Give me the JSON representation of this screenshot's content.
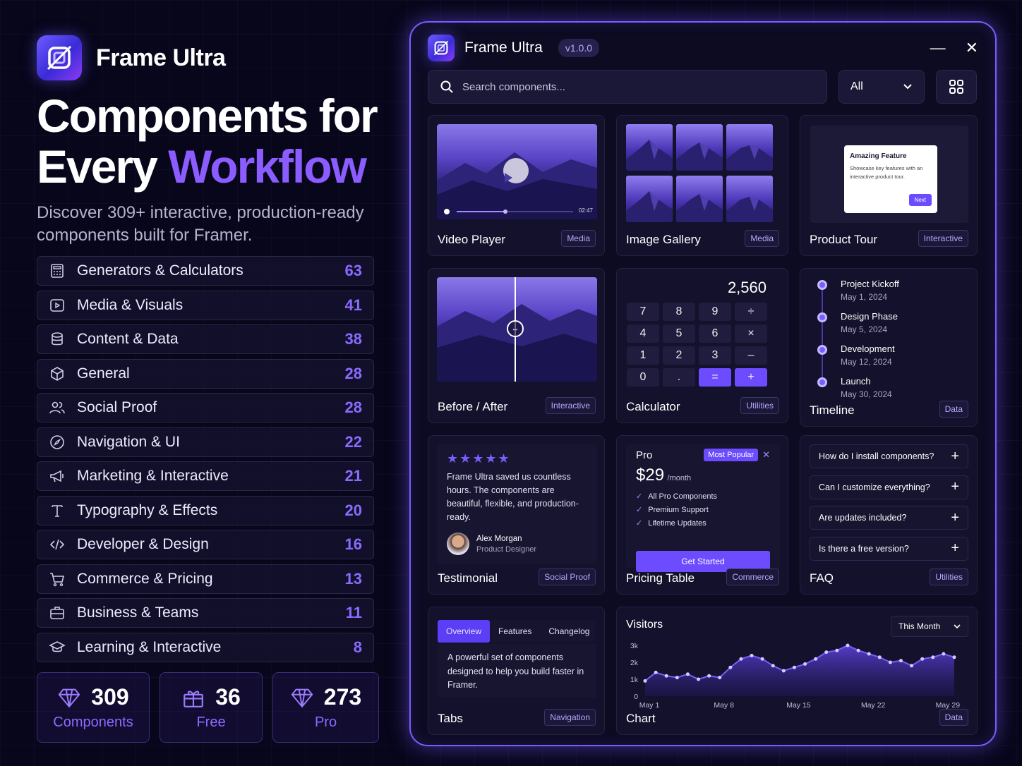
{
  "brand": {
    "name": "Frame Ultra"
  },
  "hero": {
    "line1": "Components for",
    "line2_plain": "Every",
    "line2_accent": "Workflow"
  },
  "subtitle": {
    "line1": "Discover 309+ interactive, production-ready",
    "line2": "components built for Framer."
  },
  "categories": [
    {
      "label": "Generators & Calculators",
      "count": "63",
      "icon": "calculator-icon"
    },
    {
      "label": "Media & Visuals",
      "count": "41",
      "icon": "play-icon"
    },
    {
      "label": "Content & Data",
      "count": "38",
      "icon": "database-icon"
    },
    {
      "label": "General",
      "count": "28",
      "icon": "box-icon"
    },
    {
      "label": "Social Proof",
      "count": "28",
      "icon": "users-icon"
    },
    {
      "label": "Navigation & UI",
      "count": "22",
      "icon": "compass-icon"
    },
    {
      "label": "Marketing & Interactive",
      "count": "21",
      "icon": "megaphone-icon"
    },
    {
      "label": "Typography & Effects",
      "count": "20",
      "icon": "type-icon"
    },
    {
      "label": "Developer & Design",
      "count": "16",
      "icon": "code-icon"
    },
    {
      "label": "Commerce & Pricing",
      "count": "13",
      "icon": "cart-icon"
    },
    {
      "label": "Business & Teams",
      "count": "11",
      "icon": "briefcase-icon"
    },
    {
      "label": "Learning & Interactive",
      "count": "8",
      "icon": "graduation-icon"
    }
  ],
  "stats": [
    {
      "num": "309",
      "label": "Components",
      "icon": "diamond-icon"
    },
    {
      "num": "36",
      "label": "Free",
      "icon": "gift-icon"
    },
    {
      "num": "273",
      "label": "Pro",
      "icon": "diamond-icon"
    }
  ],
  "window": {
    "title": "Frame Ultra",
    "version": "v1.0.0",
    "search_placeholder": "Search components...",
    "filter": "All"
  },
  "cards": {
    "video": {
      "name": "Video Player",
      "tag": "Media",
      "time": "02:47"
    },
    "gallery": {
      "name": "Image Gallery",
      "tag": "Media"
    },
    "tour": {
      "name": "Product Tour",
      "tag": "Interactive",
      "pop_title": "Amazing Feature",
      "pop_text": "Showcase key features with an interactive product tour.",
      "pop_btn": "Next"
    },
    "before": {
      "name": "Before / After",
      "tag": "Interactive"
    },
    "calc": {
      "name": "Calculator",
      "tag": "Utilities",
      "display": "2,560",
      "keys": [
        "7",
        "8",
        "9",
        "÷",
        "4",
        "5",
        "6",
        "×",
        "1",
        "2",
        "3",
        "–",
        "0",
        ".",
        "=",
        "+"
      ]
    },
    "timeline": {
      "name": "Timeline",
      "tag": "Data",
      "items": [
        {
          "title": "Project Kickoff",
          "date": "May 1, 2024"
        },
        {
          "title": "Design Phase",
          "date": "May 5, 2024"
        },
        {
          "title": "Development",
          "date": "May 12, 2024"
        },
        {
          "title": "Launch",
          "date": "May 30, 2024"
        }
      ]
    },
    "testimonial": {
      "name": "Testimonial",
      "tag": "Social Proof",
      "stars": "★★★★★",
      "quote": "Frame Ultra saved us countless hours. The components are beautiful, flexible, and production-ready.",
      "author": "Alex Morgan",
      "role": "Product Designer"
    },
    "pricing": {
      "name": "Pricing Table",
      "tag": "Commerce",
      "plan": "Pro",
      "badge": "Most Popular",
      "price": "$29",
      "period": "/month",
      "features": [
        "All Pro Components",
        "Premium Support",
        "Lifetime Updates"
      ],
      "cta": "Get Started"
    },
    "faq": {
      "name": "FAQ",
      "tag": "Utilities",
      "items": [
        "How do I install components?",
        "Can I customize everything?",
        "Are updates included?",
        "Is there a free version?"
      ]
    },
    "tabs": {
      "name": "Tabs",
      "tag": "Navigation",
      "tabs": [
        "Overview",
        "Features",
        "Changelog"
      ],
      "content": "A powerful set of components designed to help you build faster in Framer."
    },
    "chart": {
      "name": "Chart",
      "tag": "Data",
      "title": "Visitors",
      "range": "This Month"
    }
  },
  "chart_data": {
    "type": "area",
    "title": "Visitors",
    "x": [
      "May 1",
      "May 2",
      "May 3",
      "May 4",
      "May 5",
      "May 6",
      "May 7",
      "May 8",
      "May 9",
      "May 10",
      "May 11",
      "May 12",
      "May 13",
      "May 14",
      "May 15",
      "May 16",
      "May 17",
      "May 18",
      "May 19",
      "May 20",
      "May 21",
      "May 22",
      "May 23",
      "May 24",
      "May 25",
      "May 26",
      "May 27",
      "May 28",
      "May 29",
      "May 30"
    ],
    "x_ticks": [
      "May 1",
      "May 8",
      "May 15",
      "May 22",
      "May 29"
    ],
    "y_ticks": [
      "3k",
      "2k",
      "1k",
      "0"
    ],
    "values": [
      900,
      1400,
      1200,
      1100,
      1300,
      1000,
      1200,
      1100,
      1700,
      2200,
      2400,
      2200,
      1800,
      1500,
      1700,
      1900,
      2200,
      2600,
      2700,
      3000,
      2700,
      2500,
      2300,
      2000,
      2100,
      1800,
      2200,
      2300,
      2500,
      2300
    ],
    "ylim": [
      0,
      3000
    ],
    "series": [
      {
        "values": [
          900,
          1400,
          1200,
          1100,
          1300,
          1000,
          1200,
          1100,
          1700,
          2200,
          2400,
          2200,
          1800,
          1500,
          1700,
          1900,
          2200,
          2600,
          2700,
          3000,
          2700,
          2500,
          2300,
          2000,
          2100,
          1800,
          2200,
          2300,
          2500,
          2300
        ]
      }
    ],
    "color": "#7b5cff"
  }
}
